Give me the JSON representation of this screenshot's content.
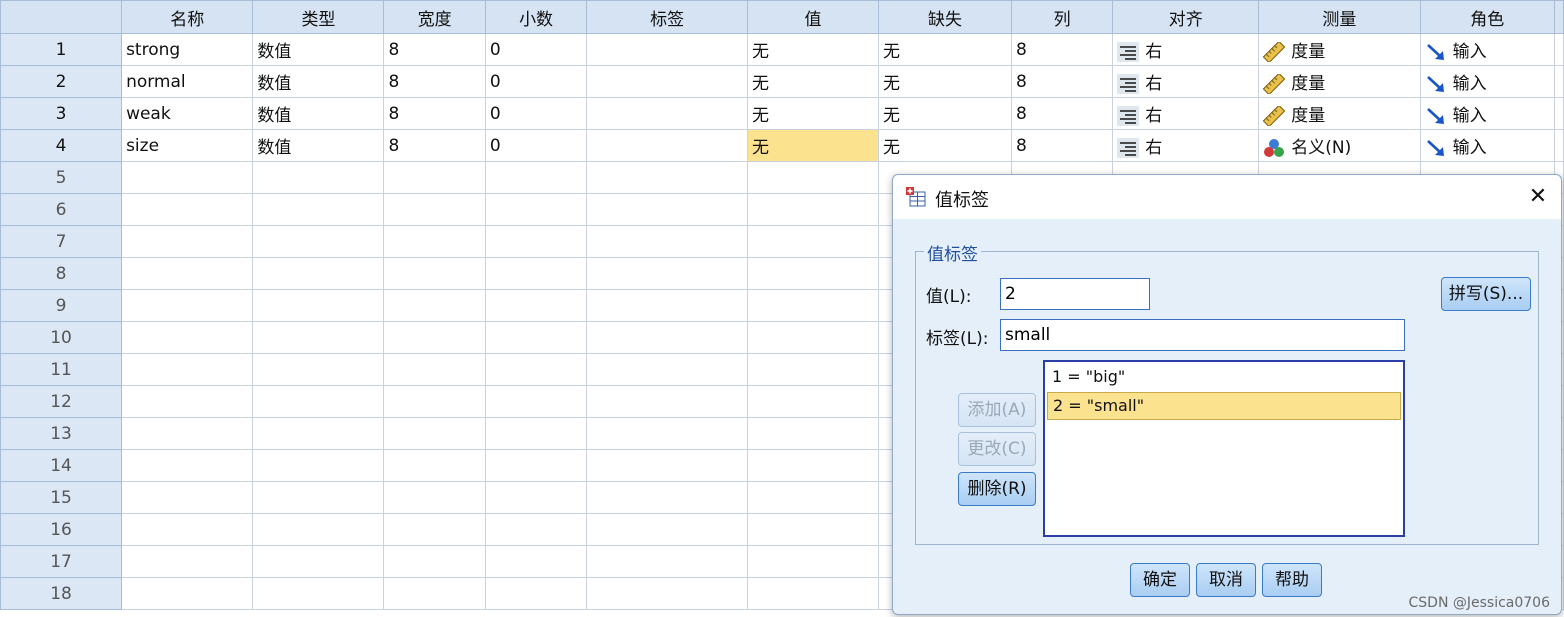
{
  "grid": {
    "columns": [
      "名称",
      "类型",
      "宽度",
      "小数",
      "标签",
      "值",
      "缺失",
      "列",
      "对齐",
      "测量",
      "角色"
    ],
    "rows": [
      {
        "num": "1",
        "name": "strong",
        "type": "数值",
        "width": "8",
        "decimals": "0",
        "label": "",
        "values": "无",
        "missing": "无",
        "columns": "8",
        "align": "右",
        "measure": "度量",
        "measure_icon": "ruler-icon",
        "role": "输入"
      },
      {
        "num": "2",
        "name": "normal",
        "type": "数值",
        "width": "8",
        "decimals": "0",
        "label": "",
        "values": "无",
        "missing": "无",
        "columns": "8",
        "align": "右",
        "measure": "度量",
        "measure_icon": "ruler-icon",
        "role": "输入"
      },
      {
        "num": "3",
        "name": "weak",
        "type": "数值",
        "width": "8",
        "decimals": "0",
        "label": "",
        "values": "无",
        "missing": "无",
        "columns": "8",
        "align": "右",
        "measure": "度量",
        "measure_icon": "ruler-icon",
        "role": "输入"
      },
      {
        "num": "4",
        "name": "size",
        "type": "数值",
        "width": "8",
        "decimals": "0",
        "label": "",
        "values": "无",
        "missing": "无",
        "columns": "8",
        "align": "右",
        "measure": "名义(N)",
        "measure_icon": "nominal-icon",
        "role": "输入"
      }
    ],
    "empty_rows": [
      "5",
      "6",
      "7",
      "8",
      "9",
      "10",
      "11",
      "12",
      "13",
      "14",
      "15",
      "16",
      "17",
      "18"
    ],
    "highlight_color": "#fbe28f"
  },
  "dialog": {
    "title": "值标签",
    "group_label": "值标签",
    "value_label": "值(L):",
    "value": "2",
    "label_label": "标签(L):",
    "label_value": "small",
    "spell_button": "拼写(S)...",
    "add_button": "添加(A)",
    "change_button": "更改(C)",
    "remove_button": "删除(R)",
    "list_items": [
      "1 = \"big\"",
      "2 = \"small\""
    ],
    "selected_index": 1,
    "ok_button": "确定",
    "cancel_button": "取消",
    "help_button": "帮助"
  },
  "watermark": "CSDN @Jessica0706"
}
